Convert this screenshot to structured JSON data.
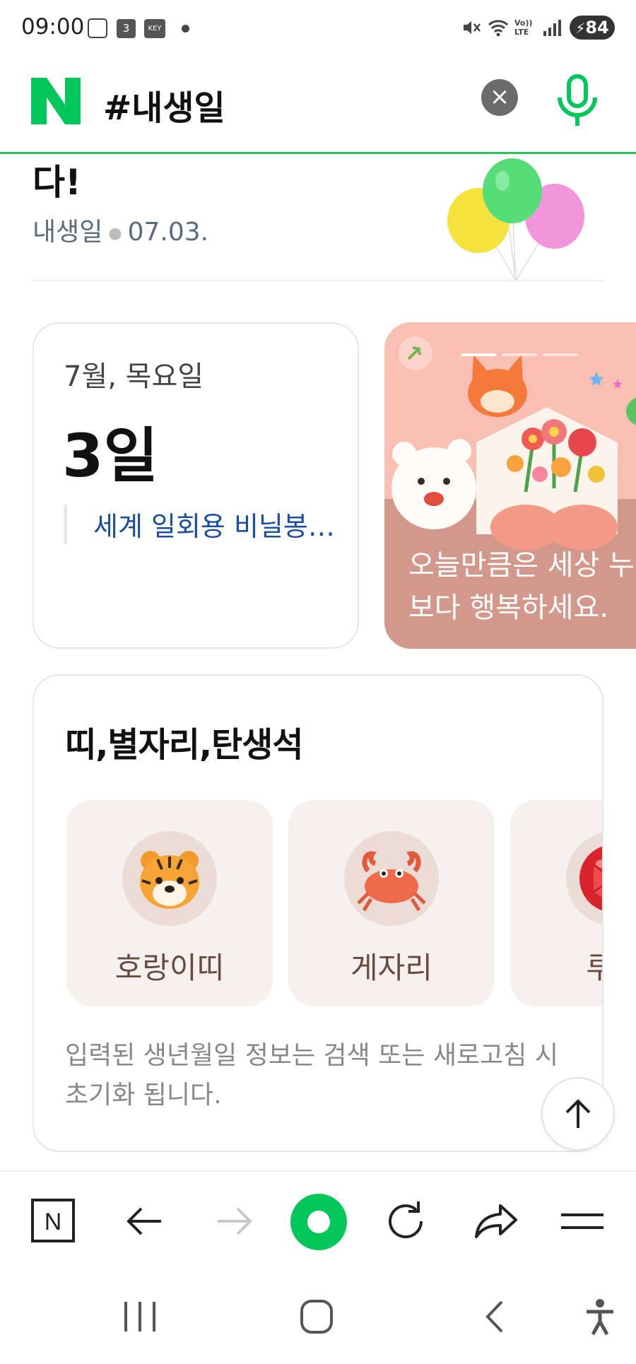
{
  "status_bar": {
    "time": "09:00",
    "calendar_badge": "3",
    "key_badge": "KEY",
    "volte_label": "Vo)) LTE",
    "battery": "84"
  },
  "search": {
    "query": "#내생일",
    "clear_label": "×"
  },
  "birthday_header": {
    "title_fragment": "다!",
    "source": "내생일",
    "date": "07.03."
  },
  "date_card": {
    "month_weekday": "7월, 목요일",
    "day": "3일",
    "event": "세계 일회용 비닐봉투 없는 날"
  },
  "promo_card": {
    "line1": "오늘만큼은 세상 누구",
    "line2": "보다 행복하세요."
  },
  "zodiac_section": {
    "title": "띠,별자리,탄생석",
    "items": [
      {
        "label": "호랑이띠",
        "icon": "tiger-icon"
      },
      {
        "label": "게자리",
        "icon": "crab-icon"
      },
      {
        "label": "루비",
        "icon": "ruby-icon"
      }
    ],
    "note": "입력된 생년월일 정보는 검색 또는 새로고침 시 초기화 됩니다."
  },
  "toolbar": {
    "home_label": "N",
    "icons": [
      "naver-home-icon",
      "back-arrow-icon",
      "forward-arrow-icon",
      "green-dot-icon",
      "refresh-icon",
      "share-icon",
      "menu-icon"
    ]
  },
  "colors": {
    "naver_green": "#03c75a",
    "link_blue": "#1a4fa0",
    "promo_bg": "#f7b9ad"
  }
}
